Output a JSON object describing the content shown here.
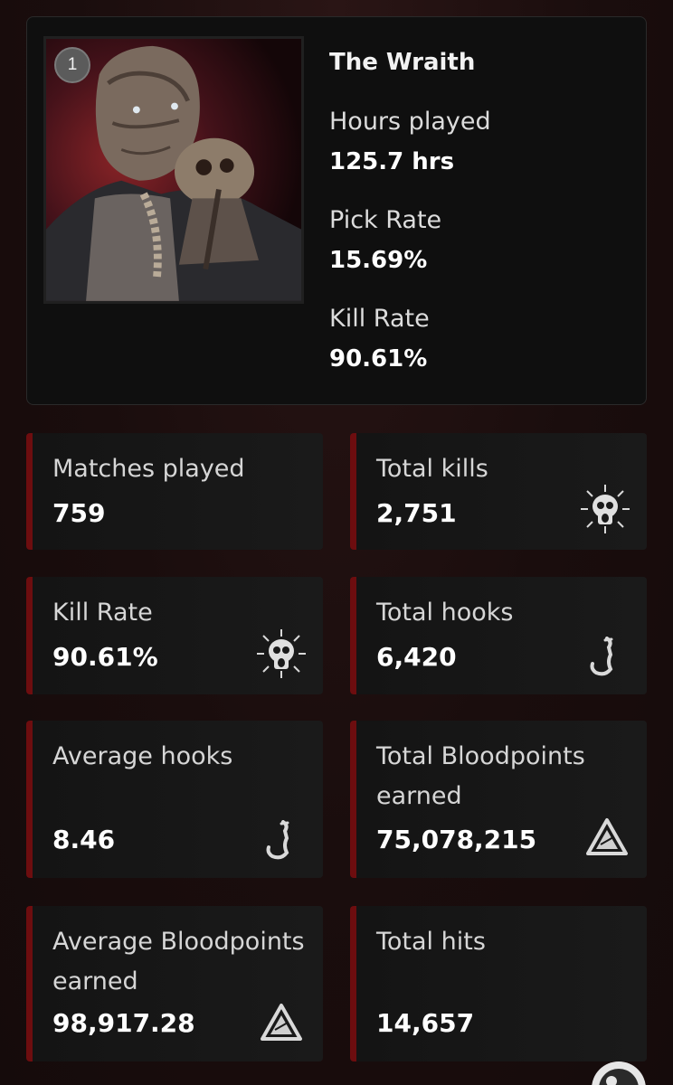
{
  "killer": {
    "rank": "1",
    "name": "The Wraith",
    "hours_label": "Hours played",
    "hours_value": "125.7 hrs",
    "pick_label": "Pick Rate",
    "pick_value": "15.69%",
    "kill_label": "Kill Rate",
    "kill_value": "90.61%"
  },
  "stats": [
    {
      "label": "Matches played",
      "value": "759",
      "icon": "none"
    },
    {
      "label": "Total kills",
      "value": "2,751",
      "icon": "skull-icon"
    },
    {
      "label": "Kill Rate",
      "value": "90.61%",
      "icon": "skull-icon"
    },
    {
      "label": "Total hooks",
      "value": "6,420",
      "icon": "hook-icon"
    },
    {
      "label": "Average hooks",
      "value": "8.46",
      "icon": "hook-icon"
    },
    {
      "label": "Total Bloodpoints earned",
      "value": "75,078,215",
      "icon": "bloodpoints-icon"
    },
    {
      "label": "Average Bloodpoints earned",
      "value": "98,917.28",
      "icon": "bloodpoints-icon"
    },
    {
      "label": "Total hits",
      "value": "14,657",
      "icon": "none"
    }
  ],
  "colors": {
    "accent": "#6d0d0f",
    "card_bg": "#161616",
    "page_bg": "#1a0e0e"
  }
}
